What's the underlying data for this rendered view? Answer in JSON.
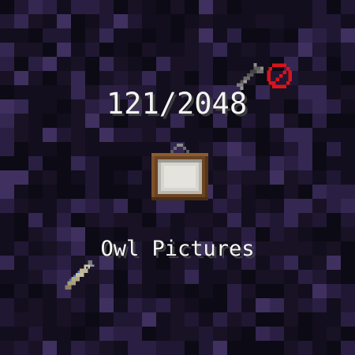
{
  "background": {
    "block": "obsidian",
    "palette": [
      "#0c0a14",
      "#120e1d",
      "#181224",
      "#201733",
      "#2a1f42",
      "#342751",
      "#3f3060"
    ]
  },
  "storage": {
    "stored_count": "121/2048",
    "used": 121,
    "capacity": 2048,
    "item_name": "Owl Pictures",
    "item_icon": "painting-icon",
    "indicators": {
      "config_icon": "wrench-icon",
      "void_icon": "no-entry-icon",
      "void_color": "#d8141b"
    },
    "label_icon": "label-tag-icon"
  }
}
